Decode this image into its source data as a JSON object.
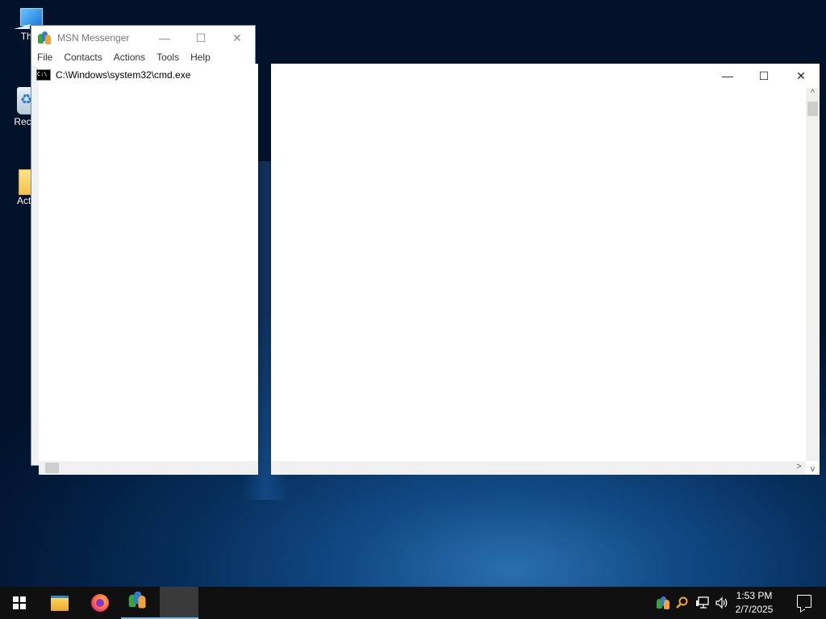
{
  "desktop": {
    "icons": [
      {
        "label": "Thi"
      },
      {
        "label": "Recyc"
      },
      {
        "label": "Activ"
      }
    ]
  },
  "msn_window": {
    "title": "MSN Messenger",
    "menu": [
      "File",
      "Contacts",
      "Actions",
      "Tools",
      "Help"
    ],
    "controls": {
      "minimize": "—",
      "maximize": "☐",
      "close": "✕"
    }
  },
  "cmd_window": {
    "title": "C:\\Windows\\system32\\cmd.exe",
    "icon_text": "C:\\"
  },
  "blank_window": {
    "controls": {
      "minimize": "—",
      "maximize": "☐",
      "close": "✕"
    },
    "scroll_up": "^",
    "scroll_right": ">",
    "scroll_down": "v"
  },
  "taskbar": {
    "clock_time": "1:53 PM",
    "clock_date": "2/7/2025",
    "tray_volume_icon": "🔊"
  },
  "colors": {
    "taskbar_bg": "#101010",
    "running_indicator": "#76b9ed"
  }
}
